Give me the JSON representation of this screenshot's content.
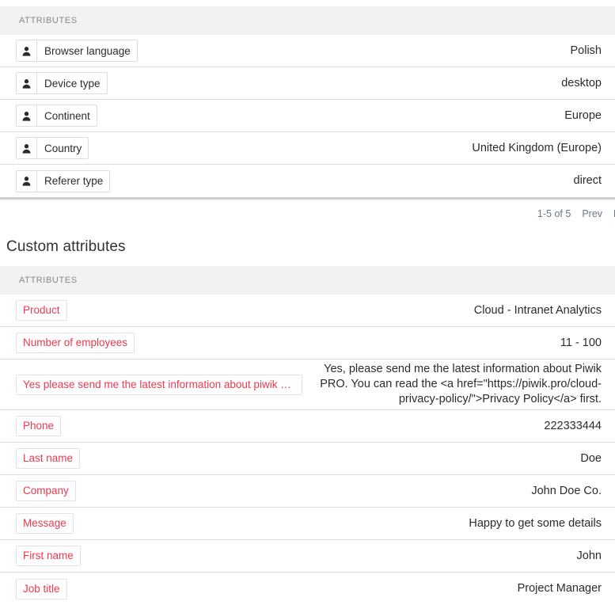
{
  "standard_attributes": {
    "column_header": "ATTRIBUTES",
    "rows": [
      {
        "icon": "person-icon",
        "name": "Browser language",
        "value": "Polish"
      },
      {
        "icon": "person-icon",
        "name": "Device type",
        "value": "desktop"
      },
      {
        "icon": "person-icon",
        "name": "Continent",
        "value": "Europe"
      },
      {
        "icon": "person-icon",
        "name": "Country",
        "value": "United Kingdom (Europe)"
      },
      {
        "icon": "person-icon",
        "name": "Referer type",
        "value": "direct"
      }
    ],
    "pagination": {
      "count": "1-5 of 5",
      "prev": "Prev",
      "next": "Ne"
    }
  },
  "custom_attributes": {
    "title": "Custom attributes",
    "column_header": "ATTRIBUTES",
    "rows": [
      {
        "name": "Product",
        "value": "Cloud - Intranet Analytics"
      },
      {
        "name": "Number of employees",
        "value": "11 - 100"
      },
      {
        "name": "Yes please send me the latest information about piwik pro you …",
        "value": "Yes, please send me the latest information about Piwik PRO. You can read the <a href=\"https://piwik.pro/cloud-privacy-policy/\">Privacy Policy</a> first."
      },
      {
        "name": "Phone",
        "value": "222333444"
      },
      {
        "name": "Last name",
        "value": "Doe"
      },
      {
        "name": "Company",
        "value": "John Doe Co."
      },
      {
        "name": "Message",
        "value": "Happy to get some details"
      },
      {
        "name": "First name",
        "value": "John"
      },
      {
        "name": "Job title",
        "value": "Project Manager"
      }
    ]
  },
  "colors": {
    "custom_attribute_text": "#ec3a4f",
    "header_bar": "#f2f2f2",
    "row_separator": "#dcdcdc",
    "pagination_text": "#6b7683"
  }
}
